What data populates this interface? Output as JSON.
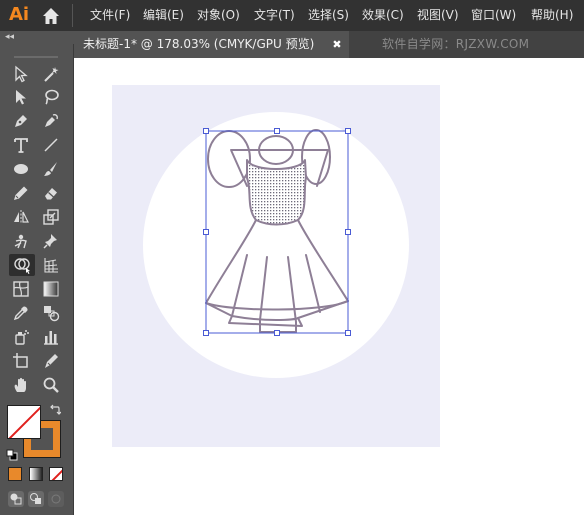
{
  "app": {
    "logo_text": "Ai",
    "menu": [
      {
        "label": "文件(F)"
      },
      {
        "label": "编辑(E)"
      },
      {
        "label": "对象(O)"
      },
      {
        "label": "文字(T)"
      },
      {
        "label": "选择(S)"
      },
      {
        "label": "效果(C)"
      },
      {
        "label": "视图(V)"
      },
      {
        "label": "窗口(W)"
      },
      {
        "label": "帮助(H)"
      }
    ]
  },
  "tabs": {
    "collapse_label": "◂◂",
    "document_tab": "未标题-1* @ 178.03% (CMYK/GPU 预览)",
    "close_label": "✖",
    "watermark": "软件自学网：RJZXW.COM"
  },
  "tools": [
    {
      "name": "selection-tool",
      "icon": "arrow-outline"
    },
    {
      "name": "magic-wand-tool",
      "icon": "magic-wand"
    },
    {
      "name": "direct-selection-tool",
      "icon": "arrow-filled"
    },
    {
      "name": "lasso-tool",
      "icon": "lasso"
    },
    {
      "name": "pen-tool",
      "icon": "pen"
    },
    {
      "name": "curvature-tool",
      "icon": "curvature-pen"
    },
    {
      "name": "type-tool",
      "icon": "type"
    },
    {
      "name": "line-segment-tool",
      "icon": "line"
    },
    {
      "name": "ellipse-tool",
      "icon": "ellipse"
    },
    {
      "name": "paintbrush-tool",
      "icon": "brush"
    },
    {
      "name": "pencil-tool",
      "icon": "pencil"
    },
    {
      "name": "eraser-tool",
      "icon": "eraser"
    },
    {
      "name": "reflect-tool",
      "icon": "reflect"
    },
    {
      "name": "scale-tool",
      "icon": "scale"
    },
    {
      "name": "puppet-warp-tool",
      "icon": "puppet-warp"
    },
    {
      "name": "pin-tool",
      "icon": "pin"
    },
    {
      "name": "shape-builder-tool",
      "icon": "shape-builder",
      "active": true
    },
    {
      "name": "perspective-grid-tool",
      "icon": "perspective-grid"
    },
    {
      "name": "mesh-tool",
      "icon": "mesh"
    },
    {
      "name": "gradient-tool",
      "icon": "gradient"
    },
    {
      "name": "eyedropper-tool",
      "icon": "eyedropper"
    },
    {
      "name": "blend-tool",
      "icon": "blend"
    },
    {
      "name": "symbol-sprayer-tool",
      "icon": "symbol-sprayer"
    },
    {
      "name": "column-graph-tool",
      "icon": "column-graph"
    },
    {
      "name": "artboard-tool",
      "icon": "artboard"
    },
    {
      "name": "slice-tool",
      "icon": "slice"
    },
    {
      "name": "hand-tool",
      "icon": "hand"
    },
    {
      "name": "zoom-tool",
      "icon": "zoom"
    }
  ],
  "colors": {
    "fill": "none",
    "stroke": "#E8892B",
    "artboard_bg": "#ECECF8",
    "circle": "#FFFFFF",
    "path_stroke": "#8E7F96",
    "selection": "#4A5BD4"
  }
}
